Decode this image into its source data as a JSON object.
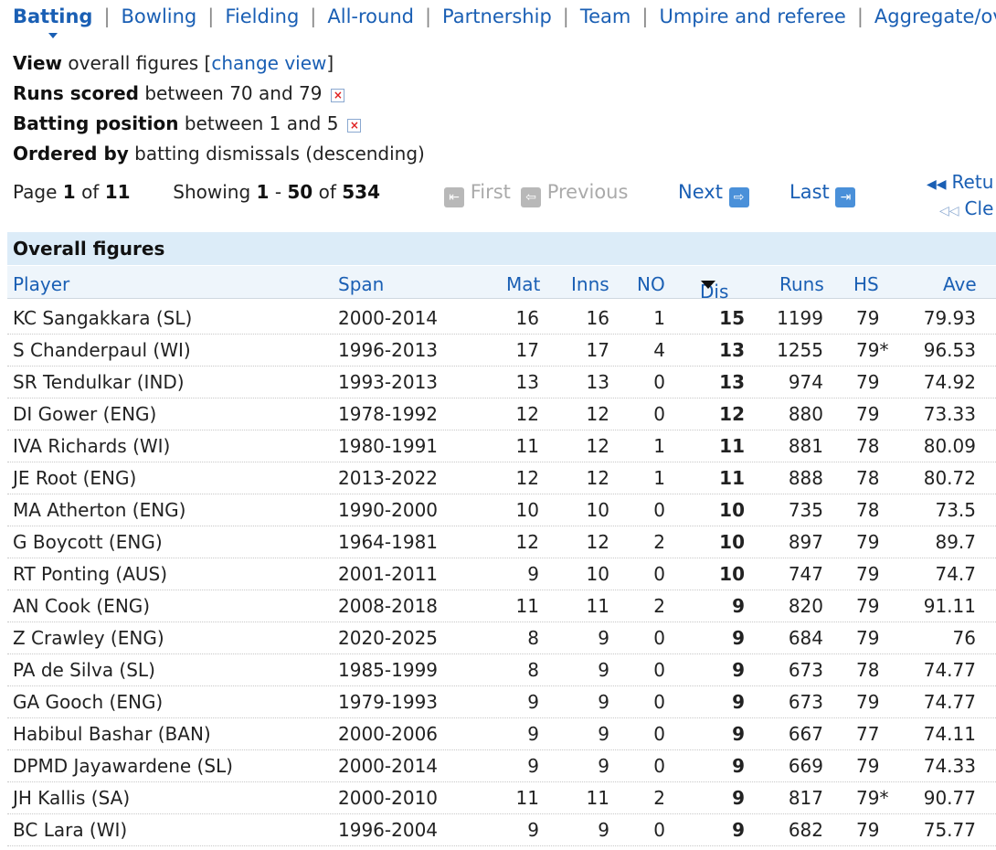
{
  "tabs": [
    "Batting",
    "Bowling",
    "Fielding",
    "All-round",
    "Partnership",
    "Team",
    "Umpire and referee",
    "Aggregate/overal"
  ],
  "filters": {
    "view_label": "View",
    "view_text": "overall figures [",
    "view_link": "change view",
    "view_close": "]",
    "runs_label": "Runs scored",
    "runs_text": "between 70 and 79",
    "pos_label": "Batting position",
    "pos_text": "between 1 and 5",
    "order_label": "Ordered by",
    "order_text": "batting dismissals (descending)"
  },
  "pager": {
    "page_prefix": "Page",
    "page": "1",
    "of": "of",
    "pages": "11",
    "showing": "Showing",
    "from": "1",
    "dash": "-",
    "to": "50",
    "of2": "of",
    "total": "534",
    "first": "First",
    "previous": "Previous",
    "next": "Next",
    "last": "Last",
    "return": "Retu",
    "clear": "Cle"
  },
  "table": {
    "title": "Overall figures",
    "columns": [
      "Player",
      "Span",
      "Mat",
      "Inns",
      "NO",
      "Dis",
      "Runs",
      "HS",
      "Ave"
    ],
    "rows": [
      [
        "KC Sangakkara (SL)",
        "2000-2014",
        "16",
        "16",
        "1",
        "15",
        "1199",
        "79",
        "79.93"
      ],
      [
        "S Chanderpaul (WI)",
        "1996-2013",
        "17",
        "17",
        "4",
        "13",
        "1255",
        "79*",
        "96.53"
      ],
      [
        "SR Tendulkar (IND)",
        "1993-2013",
        "13",
        "13",
        "0",
        "13",
        "974",
        "79",
        "74.92"
      ],
      [
        "DI Gower (ENG)",
        "1978-1992",
        "12",
        "12",
        "0",
        "12",
        "880",
        "79",
        "73.33"
      ],
      [
        "IVA Richards (WI)",
        "1980-1991",
        "11",
        "12",
        "1",
        "11",
        "881",
        "78",
        "80.09"
      ],
      [
        "JE Root (ENG)",
        "2013-2022",
        "12",
        "12",
        "1",
        "11",
        "888",
        "78",
        "80.72"
      ],
      [
        "MA Atherton (ENG)",
        "1990-2000",
        "10",
        "10",
        "0",
        "10",
        "735",
        "78",
        "73.5"
      ],
      [
        "G Boycott (ENG)",
        "1964-1981",
        "12",
        "12",
        "2",
        "10",
        "897",
        "79",
        "89.7"
      ],
      [
        "RT Ponting (AUS)",
        "2001-2011",
        "9",
        "10",
        "0",
        "10",
        "747",
        "79",
        "74.7"
      ],
      [
        "AN Cook (ENG)",
        "2008-2018",
        "11",
        "11",
        "2",
        "9",
        "820",
        "79",
        "91.11"
      ],
      [
        "Z Crawley (ENG)",
        "2020-2025",
        "8",
        "9",
        "0",
        "9",
        "684",
        "79",
        "76"
      ],
      [
        "PA de Silva (SL)",
        "1985-1999",
        "8",
        "9",
        "0",
        "9",
        "673",
        "78",
        "74.77"
      ],
      [
        "GA Gooch (ENG)",
        "1979-1993",
        "9",
        "9",
        "0",
        "9",
        "673",
        "79",
        "74.77"
      ],
      [
        "Habibul Bashar (BAN)",
        "2000-2006",
        "9",
        "9",
        "0",
        "9",
        "667",
        "77",
        "74.11"
      ],
      [
        "DPMD Jayawardene (SL)",
        "2000-2014",
        "9",
        "9",
        "0",
        "9",
        "669",
        "79",
        "74.33"
      ],
      [
        "JH Kallis (SA)",
        "2000-2010",
        "11",
        "11",
        "2",
        "9",
        "817",
        "79*",
        "90.77"
      ],
      [
        "BC Lara (WI)",
        "1996-2004",
        "9",
        "9",
        "0",
        "9",
        "682",
        "79",
        "75.77"
      ]
    ]
  }
}
